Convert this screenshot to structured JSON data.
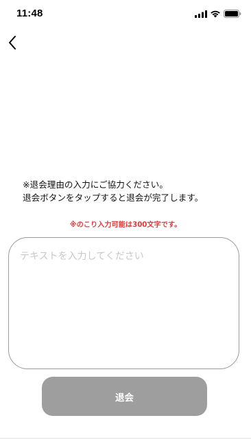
{
  "status_bar": {
    "time": "11:48"
  },
  "nav": {
    "back_icon": "chevron-left-icon"
  },
  "message": {
    "line1": "※退会理由の入力にご協力ください。",
    "line2": "退会ボタンをタップすると退会が完了します。"
  },
  "remaining_notice": "※のこり入力可能は300文字です。",
  "reason_input": {
    "value": "",
    "placeholder": "テキストを入力してください"
  },
  "withdraw_button": {
    "label": "退会"
  },
  "colors": {
    "notice": "#e03a3a",
    "button_bg": "#9e9e9e",
    "button_text": "#ffffff",
    "placeholder": "#c8c8c8",
    "input_border": "#9a9a9a"
  }
}
